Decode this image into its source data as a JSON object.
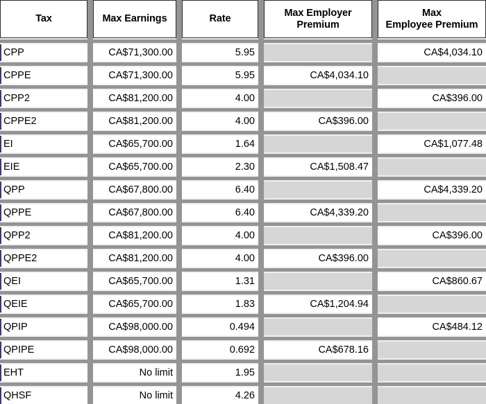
{
  "table": {
    "columns": [
      {
        "key": "tax",
        "label": "Tax",
        "align": "left"
      },
      {
        "key": "earnings",
        "label": "Max Earnings",
        "align": "right"
      },
      {
        "key": "rate",
        "label": "Rate",
        "align": "right"
      },
      {
        "key": "employer",
        "label": "Max Employer\nPremium",
        "align": "right"
      },
      {
        "key": "employee",
        "label": "Max\nEmployee Premium",
        "align": "right"
      }
    ],
    "header_labels": {
      "tax": "Tax",
      "earnings": "Max Earnings",
      "rate": "Rate",
      "employer_line1": "Max Employer",
      "employer_line2": "Premium",
      "employee_line1": "Max",
      "employee_line2": "Employee Premium"
    },
    "rows": [
      {
        "tax": "CPP",
        "earnings": "CA$71,300.00",
        "rate": "5.95",
        "employer": "",
        "employee": "CA$4,034.10"
      },
      {
        "tax": "CPPE",
        "earnings": "CA$71,300.00",
        "rate": "5.95",
        "employer": "CA$4,034.10",
        "employee": ""
      },
      {
        "tax": "CPP2",
        "earnings": "CA$81,200.00",
        "rate": "4.00",
        "employer": "",
        "employee": "CA$396.00"
      },
      {
        "tax": "CPPE2",
        "earnings": "CA$81,200.00",
        "rate": "4.00",
        "employer": "CA$396.00",
        "employee": ""
      },
      {
        "tax": "EI",
        "earnings": "CA$65,700.00",
        "rate": "1.64",
        "employer": "",
        "employee": "CA$1,077.48"
      },
      {
        "tax": "EIE",
        "earnings": "CA$65,700.00",
        "rate": "2.30",
        "employer": "CA$1,508.47",
        "employee": ""
      },
      {
        "tax": "QPP",
        "earnings": "CA$67,800.00",
        "rate": "6.40",
        "employer": "",
        "employee": "CA$4,339.20"
      },
      {
        "tax": "QPPE",
        "earnings": "CA$67,800.00",
        "rate": "6.40",
        "employer": "CA$4,339.20",
        "employee": ""
      },
      {
        "tax": "QPP2",
        "earnings": "CA$81,200.00",
        "rate": "4.00",
        "employer": "",
        "employee": "CA$396.00"
      },
      {
        "tax": "QPPE2",
        "earnings": "CA$81,200.00",
        "rate": "4.00",
        "employer": "CA$396.00",
        "employee": ""
      },
      {
        "tax": "QEI",
        "earnings": "CA$65,700.00",
        "rate": "1.31",
        "employer": "",
        "employee": "CA$860.67"
      },
      {
        "tax": "QEIE",
        "earnings": "CA$65,700.00",
        "rate": "1.83",
        "employer": "CA$1,204.94",
        "employee": ""
      },
      {
        "tax": "QPIP",
        "earnings": "CA$98,000.00",
        "rate": "0.494",
        "employer": "",
        "employee": "CA$484.12"
      },
      {
        "tax": "QPIPE",
        "earnings": "CA$98,000.00",
        "rate": "0.692",
        "employer": "CA$678.16",
        "employee": ""
      },
      {
        "tax": "EHT",
        "earnings": "No limit",
        "rate": "1.95",
        "employer": "",
        "employee": ""
      },
      {
        "tax": "QHSF",
        "earnings": "No limit",
        "rate": "4.26",
        "employer": "",
        "employee": ""
      }
    ]
  },
  "colors": {
    "separator_gray": "#949494",
    "empty_cell_gray": "#d6d6d6",
    "gutter_light": "#f0f0f0",
    "cell_white": "#ffffff",
    "header_border": "#2b2b2b",
    "tax_accent": "#3c3c64",
    "text": "#000000"
  }
}
